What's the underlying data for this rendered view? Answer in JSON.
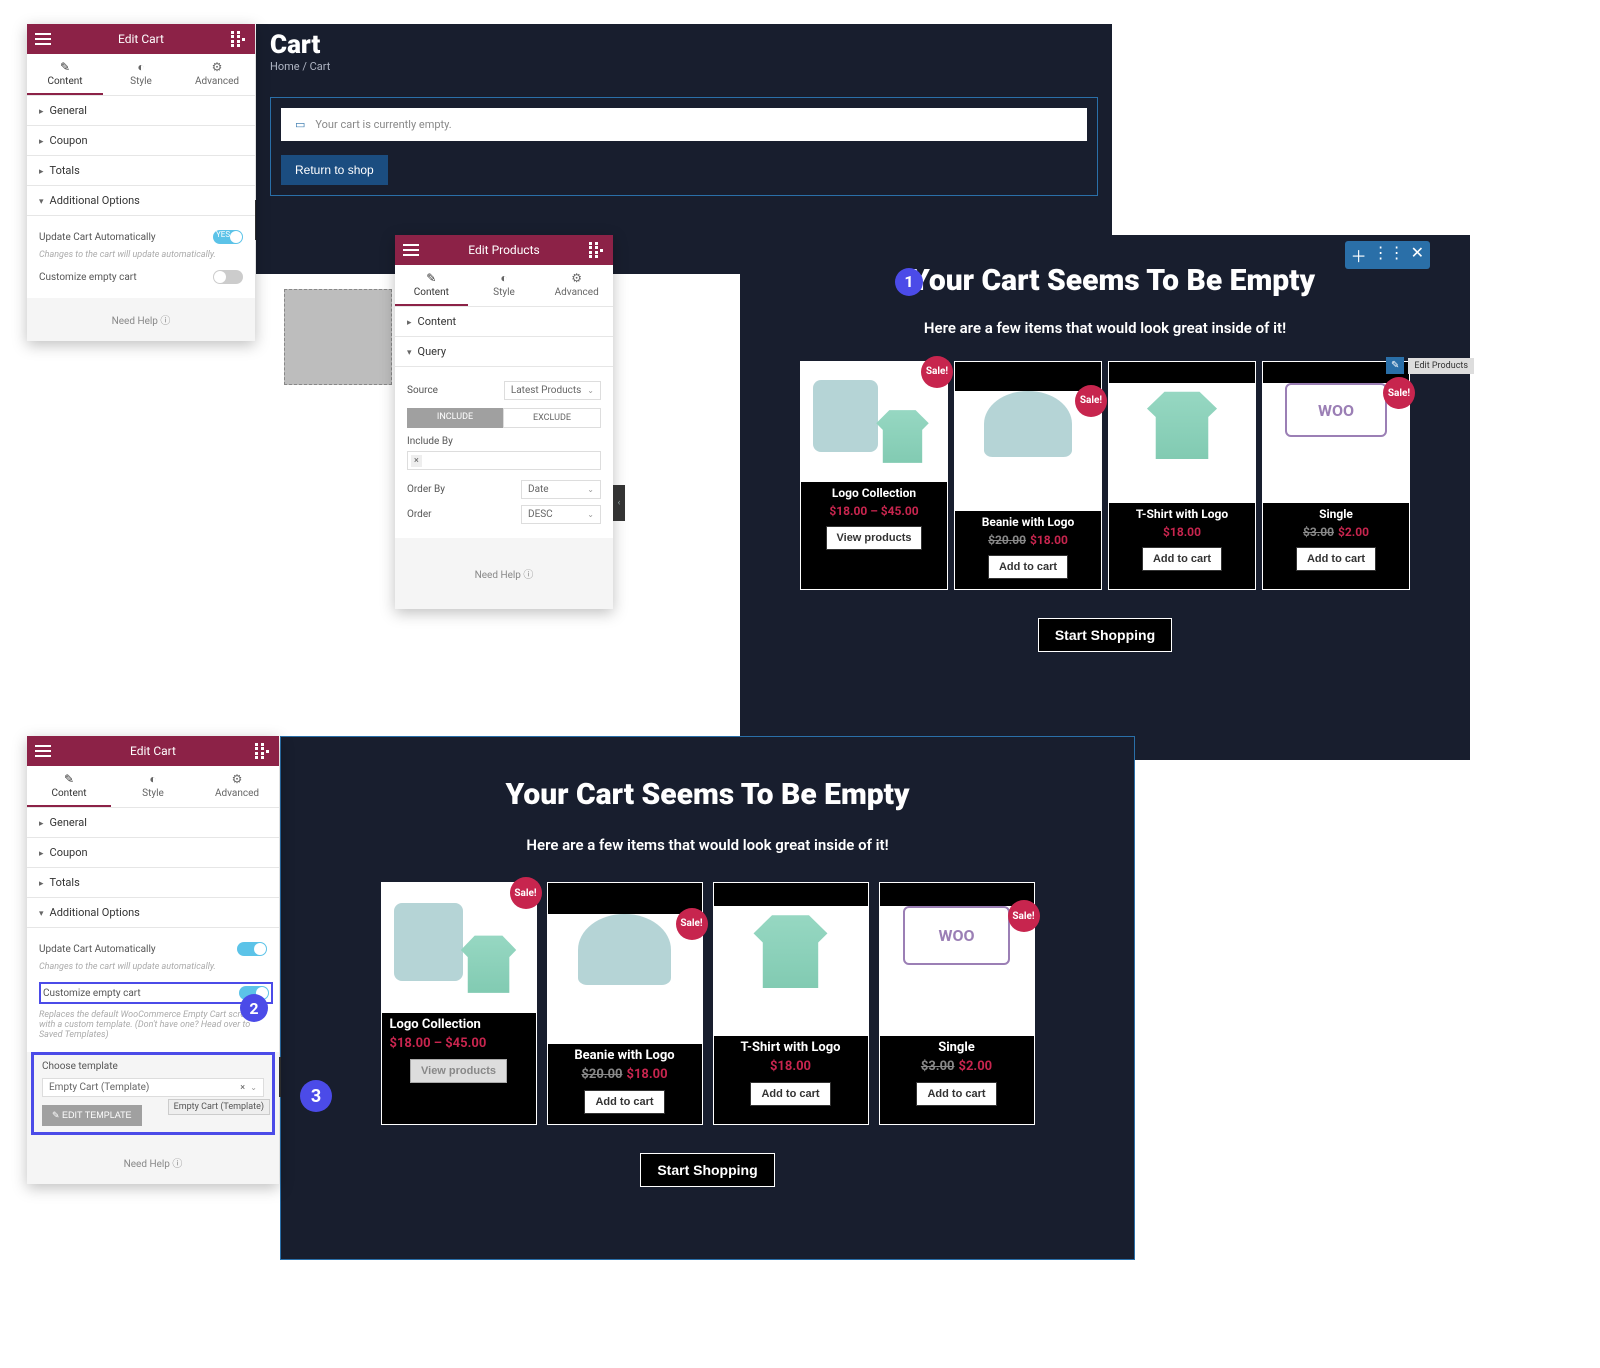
{
  "panel1": {
    "title": "Edit Cart",
    "tabs": [
      "Content",
      "Style",
      "Advanced"
    ],
    "sections": [
      "General",
      "Coupon",
      "Totals",
      "Additional Options"
    ],
    "optUpdate": "Update Cart Automatically",
    "optUpdateNote": "Changes to the cart will update automatically.",
    "optCustomize": "Customize empty cart",
    "toggleOn": "YES",
    "help": "Need Help"
  },
  "preview1": {
    "heading": "Cart",
    "breadcrumb": "Home / Cart",
    "emptyMsg": "Your cart is currently empty.",
    "returnBtn": "Return to shop"
  },
  "panel2": {
    "title": "Edit Products",
    "tabs": [
      "Content",
      "Style",
      "Advanced"
    ],
    "sectionContent": "Content",
    "sectionQuery": "Query",
    "lblSource": "Source",
    "valSource": "Latest Products",
    "btnInclude": "INCLUDE",
    "btnExclude": "EXCLUDE",
    "lblIncludeBy": "Include By",
    "lblOrderBy": "Order By",
    "valOrderBy": "Date",
    "lblOrder": "Order",
    "valOrder": "DESC",
    "help": "Need Help"
  },
  "preview2": {
    "title": "Your Cart Seems To Be Empty",
    "subtitle": "Here are a few items that would look great inside of it!",
    "editTooltip": "Edit Products",
    "startBtn": "Start Shopping",
    "products": [
      {
        "name": "Logo Collection",
        "price": "$18.00 – $45.00",
        "sale": true,
        "btn": "View products"
      },
      {
        "name": "Beanie with Logo",
        "priceOld": "$20.00",
        "price": "$18.00",
        "sale": true,
        "btn": "Add to cart"
      },
      {
        "name": "T-Shirt with Logo",
        "price": "$18.00",
        "sale": false,
        "btn": "Add to cart"
      },
      {
        "name": "Single",
        "priceOld": "$3.00",
        "price": "$2.00",
        "sale": true,
        "btn": "Add to cart"
      }
    ]
  },
  "panel3": {
    "title": "Edit Cart",
    "tabs": [
      "Content",
      "Style",
      "Advanced"
    ],
    "sections": [
      "General",
      "Coupon",
      "Totals",
      "Additional Options"
    ],
    "optUpdate": "Update Cart Automatically",
    "optUpdateNote": "Changes to the cart will update automatically.",
    "optCustomize": "Customize empty cart",
    "customizeNote": "Replaces the default WooCommerce Empty Cart screen with a custom template. (Don't have one? Head over to Saved Templates)",
    "lblChoose": "Choose template",
    "valChoose": "Empty Cart (Template)",
    "btnEditTpl": "EDIT TEMPLATE",
    "tooltipTpl": "Empty Cart (Template)",
    "help": "Need Help"
  },
  "preview3": {
    "title": "Your Cart Seems To Be Empty",
    "subtitle": "Here are a few items that would look great inside of it!",
    "startBtn": "Start Shopping",
    "products": [
      {
        "name": "Logo Collection",
        "price": "$18.00 – $45.00",
        "sale": true,
        "btn": "View products"
      },
      {
        "name": "Beanie with Logo",
        "priceOld": "$20.00",
        "price": "$18.00",
        "sale": true,
        "btn": "Add to cart"
      },
      {
        "name": "T-Shirt with Logo",
        "price": "$18.00",
        "sale": false,
        "btn": "Add to cart"
      },
      {
        "name": "Single",
        "priceOld": "$3.00",
        "price": "$2.00",
        "sale": true,
        "btn": "Add to cart"
      }
    ]
  },
  "annotations": {
    "one": "1",
    "two": "2",
    "three": "3"
  }
}
